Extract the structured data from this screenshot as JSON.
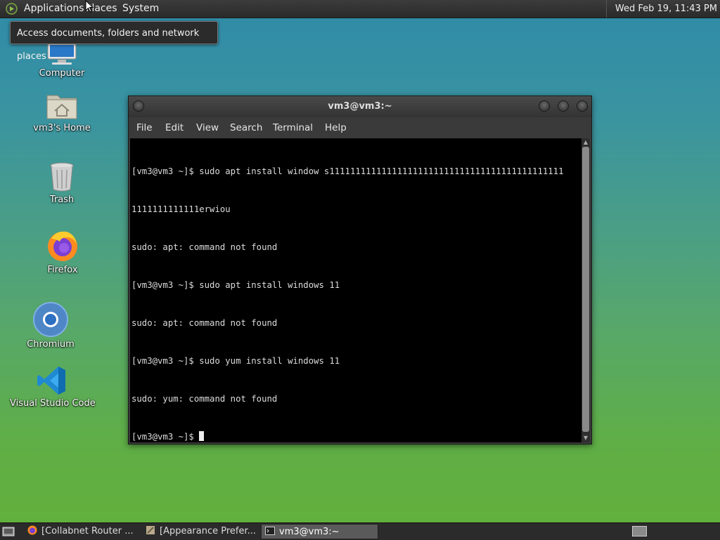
{
  "top_panel": {
    "menus": [
      "Applications",
      "Places",
      "System"
    ],
    "clock": "Wed Feb 19, 11:43 PM"
  },
  "tooltip": "Access documents, folders and network places",
  "desktop_icons": [
    {
      "label": "Computer",
      "icon": "computer-icon"
    },
    {
      "label": "vm3's Home",
      "icon": "home-folder-icon"
    },
    {
      "label": "Trash",
      "icon": "trash-icon"
    },
    {
      "label": "Firefox",
      "icon": "firefox-icon"
    },
    {
      "label": "Chromium",
      "icon": "chromium-icon"
    },
    {
      "label": "Visual Studio Code",
      "icon": "vscode-icon"
    }
  ],
  "terminal": {
    "title": "vm3@vm3:~",
    "menu": [
      "File",
      "Edit",
      "View",
      "Search",
      "Terminal",
      "Help"
    ],
    "lines": [
      "[vm3@vm3 ~]$ sudo apt install window s111111111111111111111111111111111111111111111",
      "1111111111111erwiou",
      "sudo: apt: command not found",
      "[vm3@vm3 ~]$ sudo apt install windows 11",
      "sudo: apt: command not found",
      "[vm3@vm3 ~]$ sudo yum install windows 11",
      "sudo: yum: command not found"
    ],
    "prompt": "[vm3@vm3 ~]$ "
  },
  "taskbar": {
    "tasks": [
      {
        "label": "[Collabnet Router ...",
        "icon": "firefox-icon",
        "active": false
      },
      {
        "label": "[Appearance Prefer...",
        "icon": "appearance-icon",
        "active": false
      },
      {
        "label": "vm3@vm3:~",
        "icon": "terminal-icon",
        "active": true
      }
    ]
  },
  "colors": {
    "panel": "#2b2b2b",
    "terminal_bg": "#000000",
    "terminal_fg": "#dcdcdc"
  }
}
